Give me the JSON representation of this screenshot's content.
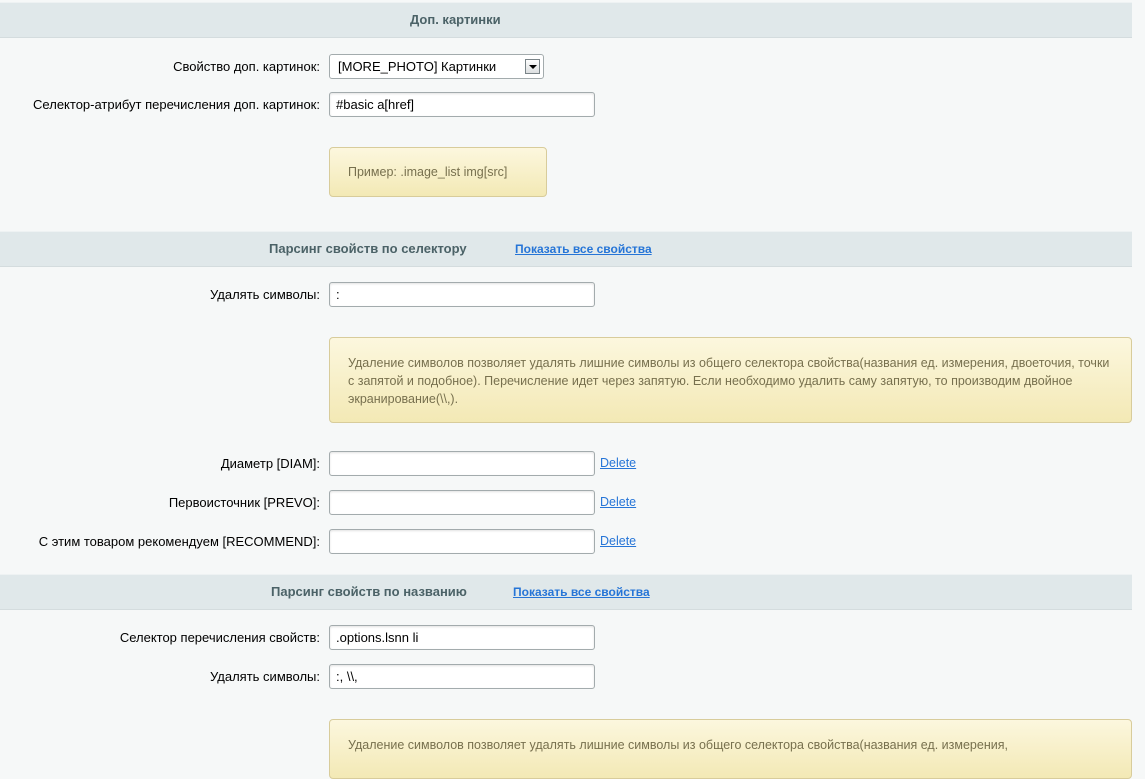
{
  "section1": {
    "title": "Доп. картинки"
  },
  "extra_images": {
    "property_label": "Свойство доп. картинок:",
    "property_value": "[MORE_PHOTO] Картинки",
    "selector_label": "Селектор-атрибут перечисления доп. картинок:",
    "selector_value": "#basic a[href]",
    "example_note": "Пример: .image_list img[src]"
  },
  "section2": {
    "title": "Парсинг свойств по селектору",
    "link": "Показать все свойства"
  },
  "selector_parsing": {
    "remove_label": "Удалять символы:",
    "remove_value": ":",
    "note": "Удаление символов позволяет удалять лишние символы из общего селектора свойства(названия ед. измерения, двоеточия, точки с запятой и подобное). Перечисление идет через запятую. Если необходимо удалить саму запятую, то производим двойное экранирование(\\\\,).",
    "rows": [
      {
        "label": "Диаметр [DIAM]:",
        "value": "",
        "delete": "Delete"
      },
      {
        "label": "Первоисточник [PREVO]:",
        "value": "",
        "delete": "Delete"
      },
      {
        "label": "С этим товаром рекомендуем [RECOMMEND]:",
        "value": "",
        "delete": "Delete"
      }
    ]
  },
  "section3": {
    "title": "Парсинг свойств по названию",
    "link": "Показать все свойства"
  },
  "name_parsing": {
    "list_selector_label": "Селектор перечисления свойств:",
    "list_selector_value": ".options.lsnn li",
    "remove_label": "Удалять символы:",
    "remove_value": ":, \\\\,",
    "note": "Удаление символов позволяет удалять лишние символы из общего селектора свойства(названия ед. измерения,"
  }
}
